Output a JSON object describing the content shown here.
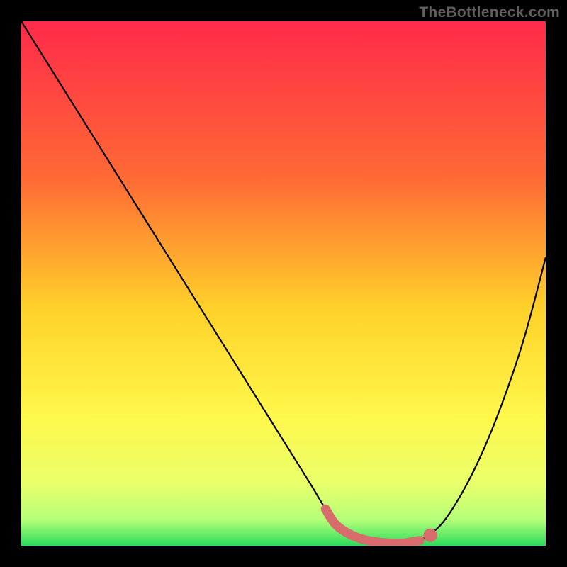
{
  "watermark": "TheBottleneck.com",
  "chart_data": {
    "type": "line",
    "title": "",
    "xlabel": "",
    "ylabel": "",
    "xlim": [
      0,
      100
    ],
    "ylim": [
      0,
      100
    ],
    "grid": false,
    "legend": false,
    "gradient_stops": [
      {
        "offset": 0.0,
        "color": "#ff2a4a"
      },
      {
        "offset": 0.3,
        "color": "#ff6a35"
      },
      {
        "offset": 0.55,
        "color": "#ffd22a"
      },
      {
        "offset": 0.75,
        "color": "#fff74a"
      },
      {
        "offset": 0.88,
        "color": "#eaff6a"
      },
      {
        "offset": 0.95,
        "color": "#b6ff7a"
      },
      {
        "offset": 1.0,
        "color": "#2bdc5b"
      }
    ],
    "series": [
      {
        "name": "bottleneck-curve",
        "color": "#000000",
        "x": [
          0,
          5,
          10,
          15,
          20,
          25,
          30,
          35,
          40,
          45,
          50,
          55,
          58,
          60,
          63,
          66,
          70,
          73,
          76,
          80,
          84,
          88,
          92,
          96,
          100
        ],
        "y": [
          100,
          92,
          84,
          76,
          68,
          60,
          52,
          44,
          36,
          28,
          20,
          12,
          7,
          4,
          2,
          1,
          0,
          0,
          1,
          4,
          10,
          18,
          28,
          40,
          55
        ]
      }
    ],
    "highlight_band": {
      "name": "optimal-range",
      "color": "#d86b6b",
      "x_start": 58,
      "x_end": 78,
      "y": 0.5,
      "thickness": 2.0
    },
    "highlight_point": {
      "name": "optimal-point",
      "color": "#d86b6b",
      "x": 78,
      "y": 2,
      "radius": 1.3
    }
  }
}
